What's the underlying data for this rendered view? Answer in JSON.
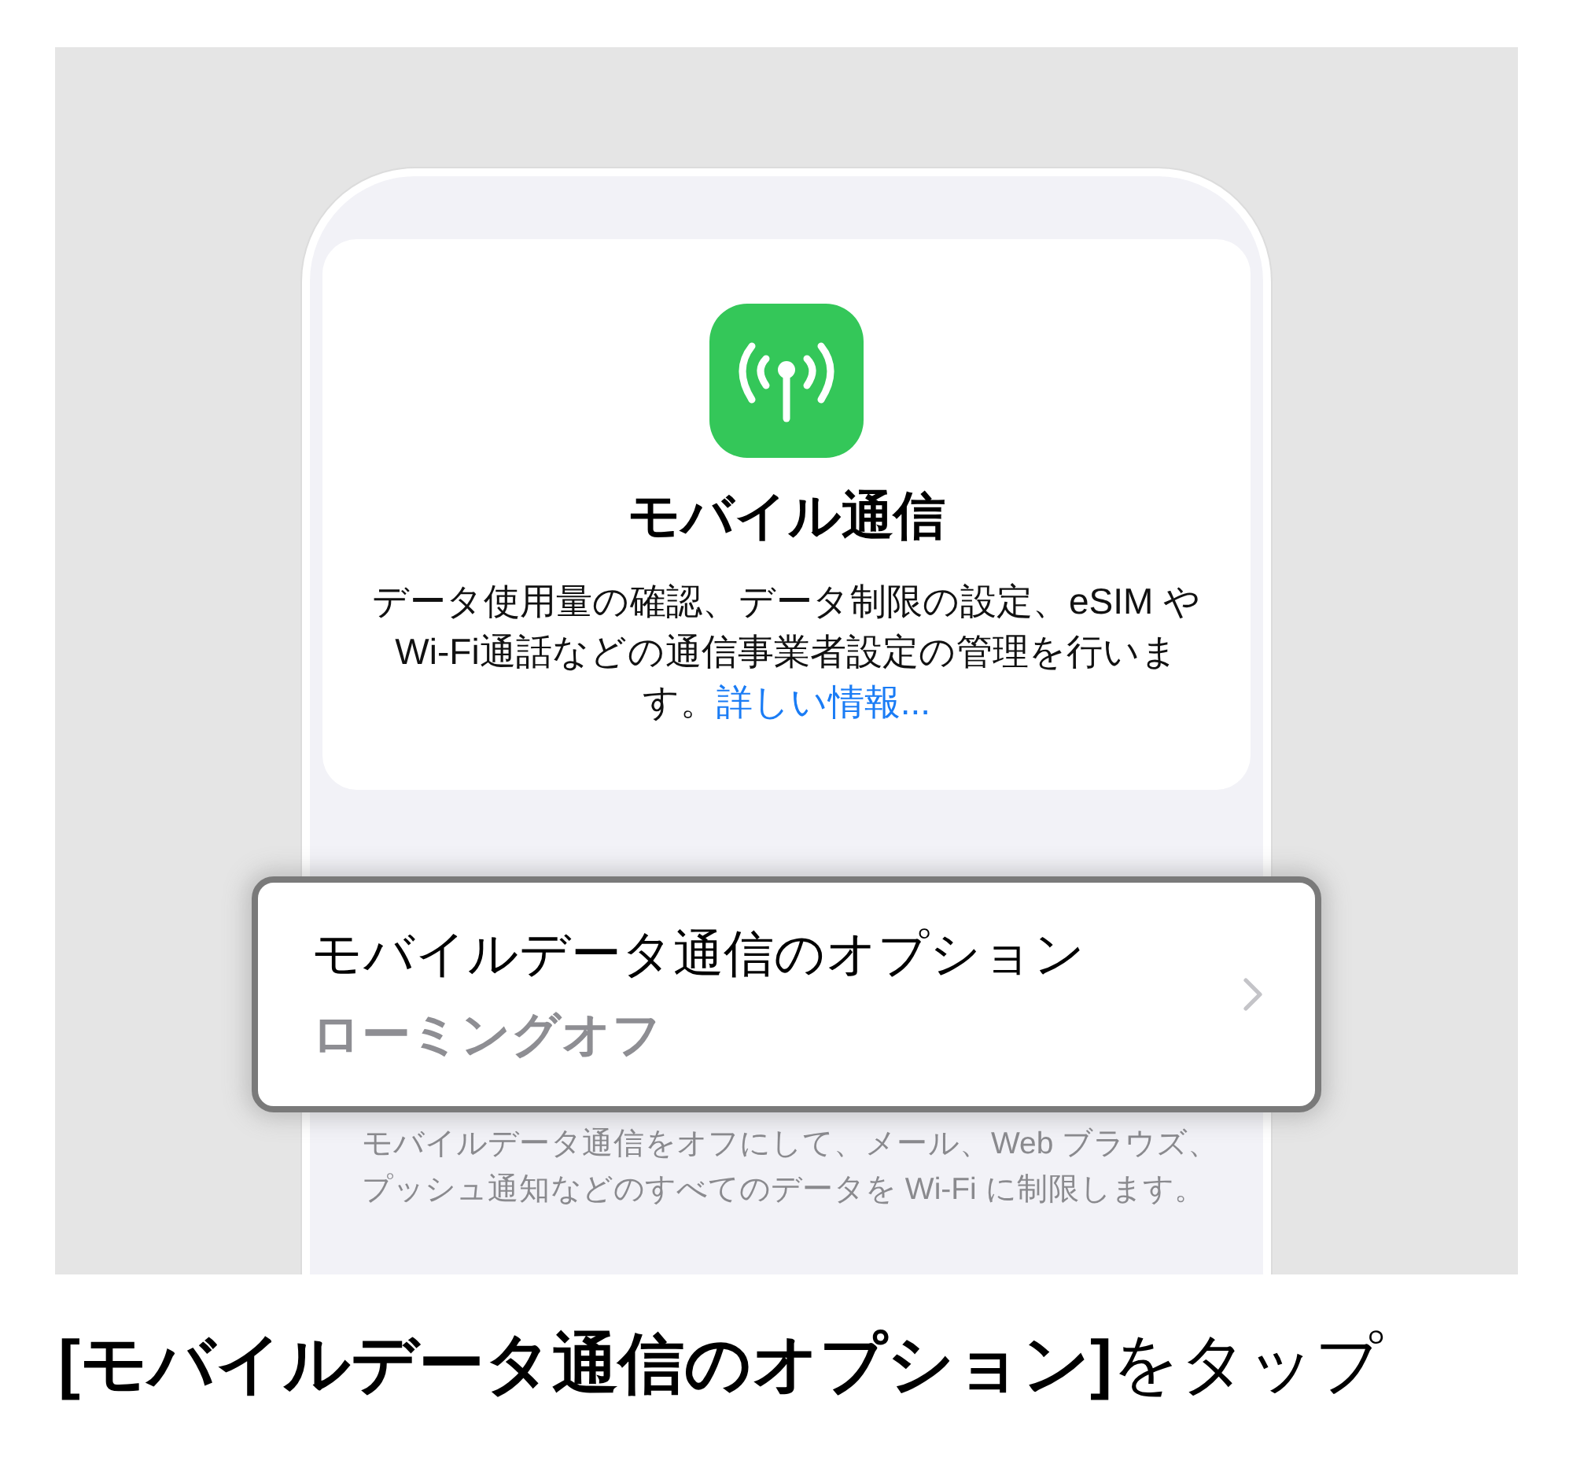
{
  "settings_card": {
    "title": "モバイル通信",
    "description": "データ使用量の確認、データ制限の設定、eSIM や Wi-Fi通話などの通信事業者設定の管理を行います。",
    "link": "詳しい情報..."
  },
  "option_row": {
    "label": "モバイルデータ通信のオプション",
    "value": "ローミングオフ",
    "highlighted": true
  },
  "footer_note": "モバイルデータ通信をオフにして、メール、Web ブラウズ、プッシュ通知などのすべてのデータを Wi-Fi に制限します。",
  "caption": "**[モバイルデータ通信のオプション]**をタップ"
}
